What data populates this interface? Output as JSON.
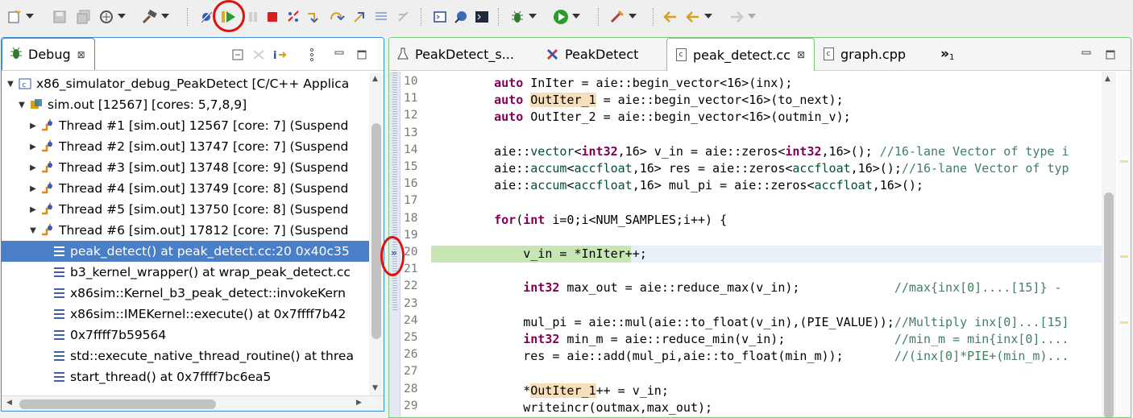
{
  "toolbar": {
    "items": [
      "new-icon",
      "save-icon",
      "save-all-icon",
      "build-all-icon",
      "build-icon",
      "skip-breakpoints-icon",
      "resume-icon",
      "suspend-icon",
      "terminate-icon",
      "disconnect-icon",
      "step-into-icon",
      "step-over-icon",
      "step-return-icon",
      "drop-to-frame-icon",
      "instruction-step-icon",
      "open-console-icon",
      "open-perspective-icon",
      "terminal-icon",
      "debug-icon",
      "run-icon",
      "external-tools-icon",
      "previous-edit-icon",
      "back-icon",
      "forward-icon"
    ],
    "colors": {
      "resume": "#2e9b2e",
      "terminate": "#d42020",
      "annotation_circle": "#e01010"
    }
  },
  "debug_view": {
    "tab_label": "Debug",
    "close_glyph": "⊠",
    "tree": [
      {
        "text": "x86_simulator_debug_PeakDetect [C/C++ Applica",
        "level": 0,
        "expanded": true,
        "icon": "launch-icon"
      },
      {
        "text": "sim.out [12567] [cores: 5,7,8,9]",
        "level": 1,
        "expanded": true,
        "icon": "process-icon"
      },
      {
        "text": "Thread #1 [sim.out] 12567 [core: 7] (Suspend",
        "level": 2,
        "expanded": false,
        "icon": "thread-icon"
      },
      {
        "text": "Thread #2 [sim.out] 13747 [core: 7] (Suspend",
        "level": 2,
        "expanded": false,
        "icon": "thread-icon"
      },
      {
        "text": "Thread #3 [sim.out] 13748 [core: 9] (Suspend",
        "level": 2,
        "expanded": false,
        "icon": "thread-icon"
      },
      {
        "text": "Thread #4 [sim.out] 13749 [core: 8] (Suspend",
        "level": 2,
        "expanded": false,
        "icon": "thread-icon"
      },
      {
        "text": "Thread #5 [sim.out] 13750 [core: 8] (Suspend",
        "level": 2,
        "expanded": false,
        "icon": "thread-icon"
      },
      {
        "text": "Thread #6 [sim.out] 17812 [core: 7] (Suspend",
        "level": 2,
        "expanded": true,
        "icon": "thread-icon"
      },
      {
        "text": "peak_detect() at peak_detect.cc:20 0x40c35",
        "level": 3,
        "selected": true,
        "icon": "stack-frame-icon"
      },
      {
        "text": "b3_kernel_wrapper() at wrap_peak_detect.cc",
        "level": 3,
        "icon": "stack-frame-icon"
      },
      {
        "text": "x86sim::Kernel_b3_peak_detect::invokeKern",
        "level": 3,
        "icon": "stack-frame-icon"
      },
      {
        "text": "x86sim::IMEKernel::execute() at 0x7ffff7b42",
        "level": 3,
        "icon": "stack-frame-icon"
      },
      {
        "text": "0x7ffff7b59564",
        "level": 3,
        "icon": "stack-frame-icon"
      },
      {
        "text": "std::execute_native_thread_routine() at threa",
        "level": 3,
        "icon": "stack-frame-icon"
      },
      {
        "text": "start_thread() at 0x7ffff7bc6ea5",
        "level": 3,
        "icon": "stack-frame-icon"
      }
    ]
  },
  "editor": {
    "tabs": [
      {
        "label": "PeakDetect_s...",
        "icon": "flask-icon",
        "active": false
      },
      {
        "label": "PeakDetect",
        "icon": "tools-icon",
        "active": false
      },
      {
        "label": "peak_detect.cc",
        "icon": "c-file-icon",
        "active": true,
        "close": "⊠"
      },
      {
        "label": "graph.cpp",
        "icon": "c-file-icon",
        "active": false
      }
    ],
    "overflow_label": "»",
    "overflow_count": "1",
    "current_line": "20",
    "lines": [
      {
        "n": "10",
        "html": "    <span class=\"kw\">auto</span> InIter = aie::begin_vector&lt;16&gt;(inx);"
      },
      {
        "n": "11",
        "html": "    <span class=\"kw\">auto</span> <span class=\"hl\">OutIter_1</span> = aie::begin_vector&lt;16&gt;(to_next);"
      },
      {
        "n": "12",
        "html": "    <span class=\"kw\">auto</span> OutIter_2 = aie::begin_vector&lt;16&gt;(outmin_v);"
      },
      {
        "n": "13",
        "html": ""
      },
      {
        "n": "14",
        "html": "    aie::<span class=\"ns\">vector</span>&lt;<span class=\"kw\">int32</span>,16&gt; v_in = aie::zeros&lt;<span class=\"kw\">int32</span>,16&gt;(); <span class=\"cm\">//16-lane Vector of type i</span>"
      },
      {
        "n": "15",
        "html": "    aie::<span class=\"ns\">accum</span>&lt;<span class=\"ns\">accfloat</span>,16&gt; res = aie::zeros&lt;<span class=\"ns\">accfloat</span>,16&gt;();<span class=\"cm\">//16-lane Vector of typ</span>"
      },
      {
        "n": "16",
        "html": "    aie::<span class=\"ns\">accum</span>&lt;<span class=\"ns\">accfloat</span>,16&gt; mul_pi = aie::zeros&lt;<span class=\"ns\">accfloat</span>,16&gt;();"
      },
      {
        "n": "17",
        "html": ""
      },
      {
        "n": "18",
        "html": "    <span class=\"kw\">for</span>(<span class=\"kw\">int</span> i=0;i&lt;NUM_SAMPLES;i++) {"
      },
      {
        "n": "19",
        "html": ""
      },
      {
        "n": "20",
        "html": "        v_in = *InIter++;",
        "current": true
      },
      {
        "n": "21",
        "html": ""
      },
      {
        "n": "22",
        "html": "        <span class=\"kw\">int32</span> max_out = aie::reduce_max(v_in);             <span class=\"cm\">//max{inx[0]....[15]} - </span>"
      },
      {
        "n": "23",
        "html": ""
      },
      {
        "n": "24",
        "html": "        mul_pi = aie::mul(aie::to_float(v_in),(PIE_VALUE));<span class=\"cm\">//Multiply inx[0]...[15]</span>"
      },
      {
        "n": "25",
        "html": "        <span class=\"kw\">int32</span> min_m = aie::reduce_min(v_in);               <span class=\"cm\">//min_m = min{inx[0]....</span>"
      },
      {
        "n": "26",
        "html": "        res = aie::add(mul_pi,aie::to_float(min_m));       <span class=\"cm\">//(inx[0]*PIE+(min_m)...</span>"
      },
      {
        "n": "27",
        "html": ""
      },
      {
        "n": "28",
        "html": "        *<span class=\"hl\">OutIter_1</span>++ = v_in;"
      },
      {
        "n": "29",
        "html": "        writeincr(outmax,max_out);"
      }
    ]
  }
}
